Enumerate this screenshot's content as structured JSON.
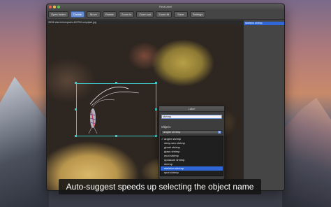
{
  "window": {
    "title": "RectLabel"
  },
  "toolbar": {
    "buttons": [
      {
        "label": "Open folder",
        "active": false
      },
      {
        "label": "Create",
        "active": true
      },
      {
        "label": "Move",
        "active": false
      },
      {
        "label": "Rotate",
        "active": false
      },
      {
        "label": "Zoom in",
        "active": false
      },
      {
        "label": "Zoom out",
        "active": false
      },
      {
        "label": "Zoom fit",
        "active": false
      },
      {
        "label": "Save",
        "active": false
      },
      {
        "label": "Settings",
        "active": false
      }
    ]
  },
  "pathbar": {
    "text": "35/36 vlad-tchompalov-403790-unsplash.jpg"
  },
  "sidebar": {
    "items": [
      "skeleton shrimp"
    ]
  },
  "dialog": {
    "title": "Label",
    "input_value": "shrimp",
    "object_label": "Object",
    "selected": "angler shrimp",
    "options": [
      {
        "label": "angler shrimp",
        "checked": true,
        "highlighted": false
      },
      {
        "label": "deep-sea shrimp",
        "checked": false,
        "highlighted": false
      },
      {
        "label": "ghost shrimp",
        "checked": false,
        "highlighted": false
      },
      {
        "label": "glass shrimp",
        "checked": false,
        "highlighted": false
      },
      {
        "label": "mud shrimp",
        "checked": false,
        "highlighted": false
      },
      {
        "label": "opossum shrimp",
        "checked": false,
        "highlighted": false
      },
      {
        "label": "shrimp",
        "checked": false,
        "highlighted": false
      },
      {
        "label": "skeleton shrimp",
        "checked": false,
        "highlighted": true
      },
      {
        "label": "spot shrimp",
        "checked": false,
        "highlighted": false
      }
    ]
  },
  "caption": {
    "text": "Auto-suggest speeds up selecting the object name"
  },
  "colors": {
    "accent": "#2f68d6",
    "bbox": "#3fc6c6"
  }
}
